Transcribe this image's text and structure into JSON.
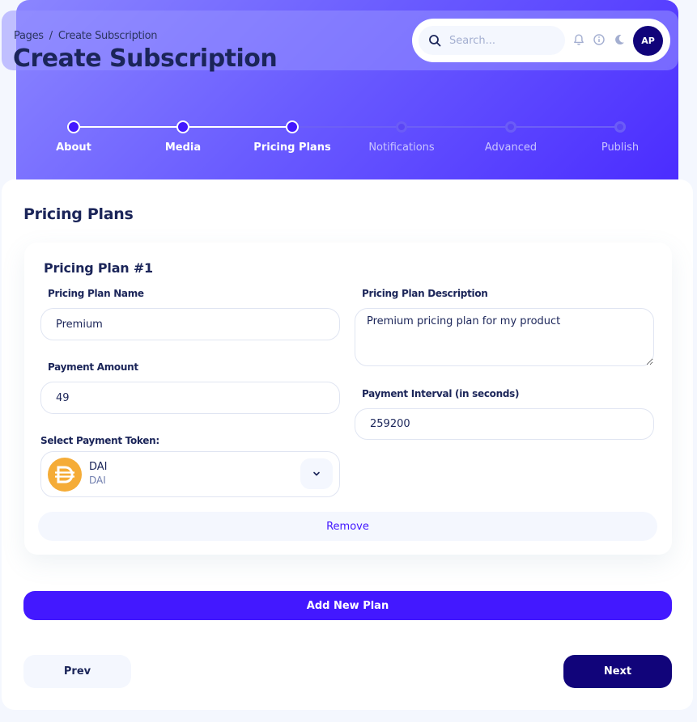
{
  "breadcrumb": {
    "root": "Pages",
    "separator": "/",
    "current": "Create Subscription"
  },
  "page_title": "Create Subscription",
  "navbar": {
    "search_placeholder": "Search...",
    "icons": [
      "search-icon",
      "bell-icon",
      "info-icon",
      "moon-icon"
    ],
    "avatar_initials": "AP"
  },
  "stepper": {
    "steps": [
      {
        "label": "About",
        "status": "done"
      },
      {
        "label": "Media",
        "status": "done"
      },
      {
        "label": "Pricing Plans",
        "status": "current"
      },
      {
        "label": "Notifications",
        "status": "todo"
      },
      {
        "label": "Advanced",
        "status": "todo"
      },
      {
        "label": "Publish",
        "status": "todo"
      }
    ]
  },
  "section_title": "Pricing Plans",
  "plan": {
    "title": "Pricing Plan #1",
    "name_label": "Pricing Plan Name",
    "name_value": "Premium",
    "description_label": "Pricing Plan Description",
    "description_value": "Premium pricing plan for my product",
    "amount_label": "Payment Amount",
    "amount_value": "49",
    "interval_label": "Payment Interval (in seconds)",
    "interval_value": "259200",
    "token_label": "Select Payment Token:",
    "token_name": "DAI",
    "token_symbol": "DAI",
    "remove_label": "Remove"
  },
  "actions": {
    "add_plan": "Add New Plan",
    "prev": "Prev",
    "next": "Next"
  },
  "colors": {
    "brand": "#4318FF",
    "navy": "#11047A",
    "text": "#1B2559",
    "dai": "#F5AC37"
  }
}
